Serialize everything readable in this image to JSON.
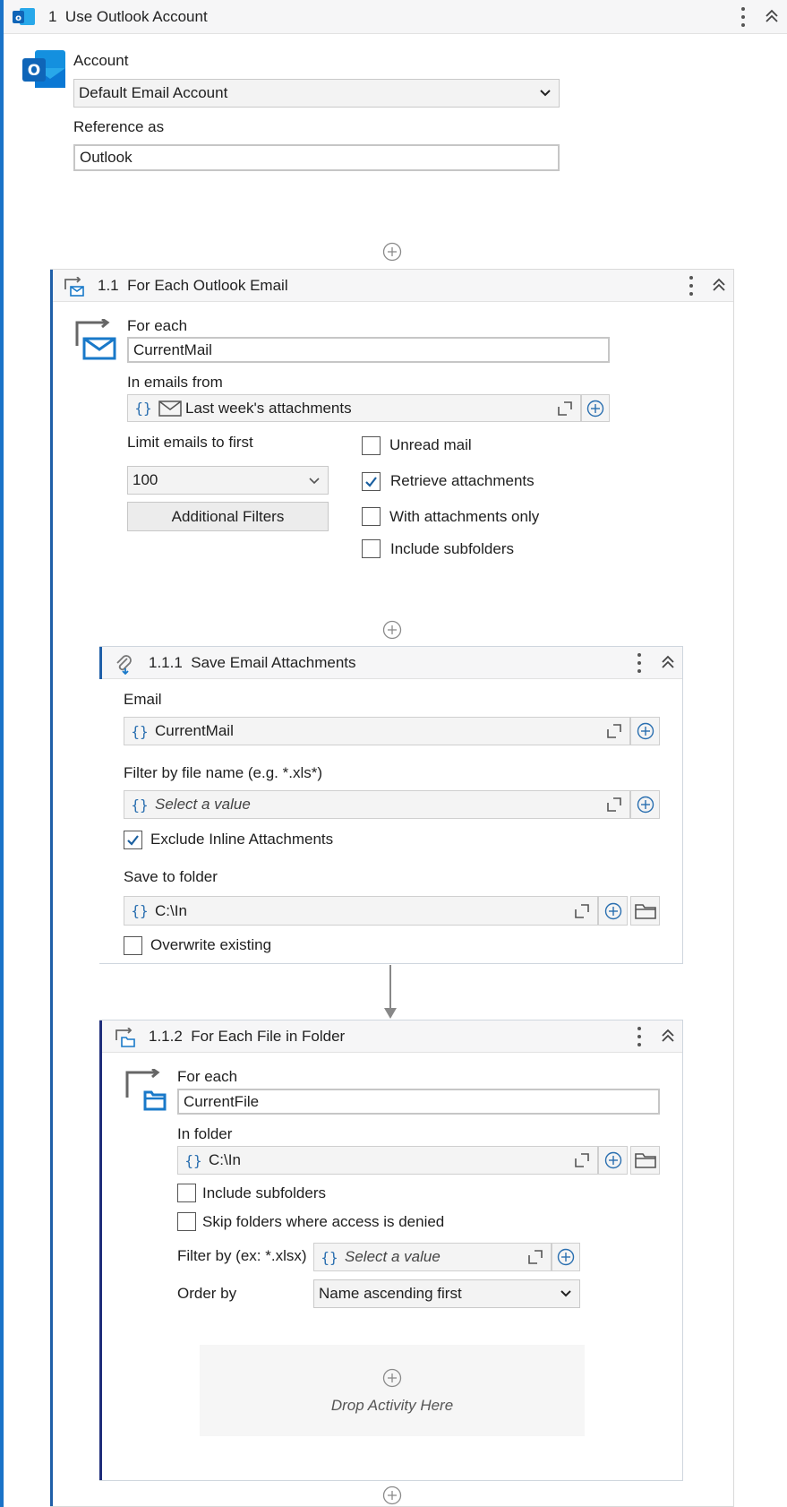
{
  "colors": {
    "primary_bar": "#1a73c8",
    "secondary_bar": "#1f5fa8",
    "tertiary_bar": "#1e2d7a",
    "icon_blue": "#1979c9"
  },
  "step1": {
    "number": "1",
    "title": "Use Outlook Account",
    "account_label": "Account",
    "account_value": "Default Email Account",
    "reference_label": "Reference as",
    "reference_value": "Outlook"
  },
  "step11": {
    "number": "1.1",
    "title": "For Each Outlook Email",
    "for_each_label": "For each",
    "for_each_value": "CurrentMail",
    "in_emails_label": "In emails from",
    "in_emails_value": "Last week's attachments",
    "limit_label": "Limit emails to first",
    "limit_value": "100",
    "filters_button": "Additional Filters",
    "checkboxes": [
      {
        "label": "Unread mail",
        "checked": false
      },
      {
        "label": "Retrieve attachments",
        "checked": true
      },
      {
        "label": "With attachments only",
        "checked": false
      },
      {
        "label": "Include subfolders",
        "checked": false
      }
    ]
  },
  "step111": {
    "number": "1.1.1",
    "title": "Save Email Attachments",
    "email_label": "Email",
    "email_value": "CurrentMail",
    "filter_label": "Filter by file name (e.g. *.xls*)",
    "filter_placeholder": "Select a value",
    "exclude_label": "Exclude Inline Attachments",
    "exclude_checked": true,
    "save_label": "Save to folder",
    "save_value": "C:\\In",
    "overwrite_label": "Overwrite existing",
    "overwrite_checked": false
  },
  "step112": {
    "number": "1.1.2",
    "title": "For Each File in Folder",
    "for_each_label": "For each",
    "for_each_value": "CurrentFile",
    "in_folder_label": "In folder",
    "in_folder_value": "C:\\In",
    "include_sub_label": "Include subfolders",
    "skip_label": "Skip folders where access is denied",
    "filter_label": "Filter by (ex: *.xlsx)",
    "filter_placeholder": "Select a value",
    "order_label": "Order by",
    "order_value": "Name ascending first",
    "drop_text": "Drop Activity Here"
  }
}
